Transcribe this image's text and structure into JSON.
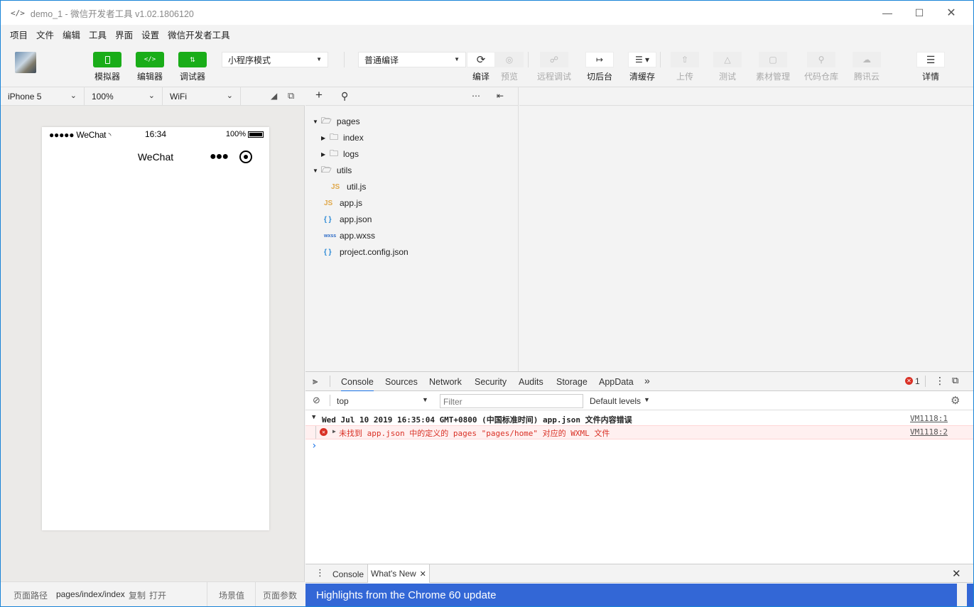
{
  "window": {
    "title": "demo_1 - 微信开发者工具 v1.02.1806120",
    "icon": "code-icon"
  },
  "menu": [
    "项目",
    "文件",
    "编辑",
    "工具",
    "界面",
    "设置",
    "微信开发者工具"
  ],
  "toolbar": {
    "simulator_label": "模拟器",
    "editor_label": "编辑器",
    "debugger_label": "调试器",
    "mode_select": "小程序模式",
    "compile_select": "普通编译",
    "compile_label": "编译",
    "preview_label": "预览",
    "remote_debug_label": "远程调试",
    "background_label": "切后台",
    "clear_cache_label": "清缓存",
    "upload_label": "上传",
    "test_label": "测试",
    "material_label": "素材管理",
    "repo_label": "代码仓库",
    "tencent_cloud_label": "腾讯云",
    "details_label": "详情",
    "accent_color": "#1aad19"
  },
  "simulator": {
    "device": "iPhone 5",
    "zoom": "100%",
    "network": "WiFi",
    "status_left": "●●●●● WeChat",
    "status_time": "16:34",
    "status_battery": "100%",
    "nav_title": "WeChat",
    "footer_path_label": "页面路径",
    "footer_path": "pages/index/index",
    "footer_copy": "复制",
    "footer_open": "打开",
    "footer_scene": "场景值",
    "footer_params": "页面参数"
  },
  "tree": {
    "items": [
      {
        "label": "pages",
        "type": "folder",
        "expanded": true
      },
      {
        "label": "index",
        "type": "folder",
        "expanded": false
      },
      {
        "label": "logs",
        "type": "folder",
        "expanded": false
      },
      {
        "label": "utils",
        "type": "folder",
        "expanded": true
      },
      {
        "label": "util.js",
        "type": "js"
      },
      {
        "label": "app.js",
        "type": "js"
      },
      {
        "label": "app.json",
        "type": "json"
      },
      {
        "label": "app.wxss",
        "type": "wxss"
      },
      {
        "label": "project.config.json",
        "type": "json"
      }
    ],
    "js_badge": "JS",
    "json_badge": "{ }",
    "wxss_badge": "wxss"
  },
  "devtools": {
    "tabs": [
      "Console",
      "Sources",
      "Network",
      "Security",
      "Audits",
      "Storage",
      "AppData"
    ],
    "active_tab": "Console",
    "error_count": "1",
    "context": "top",
    "filter_placeholder": "Filter",
    "levels": "Default levels",
    "group_header": "Wed Jul 10 2019 16:35:04 GMT+0800 (中国标准时间)  app.json 文件内容错误",
    "group_source": "VM1118:1",
    "error_message": "未找到 app.json 中的定义的 pages \"pages/home\" 对应的 WXML 文件",
    "error_source": "VM1118:2",
    "prompt": "›",
    "drawer_tabs": [
      "Console",
      "What's New"
    ],
    "banner": "Highlights from the Chrome 60 update",
    "error_color": "#d93025",
    "banner_color": "#3367d6"
  }
}
